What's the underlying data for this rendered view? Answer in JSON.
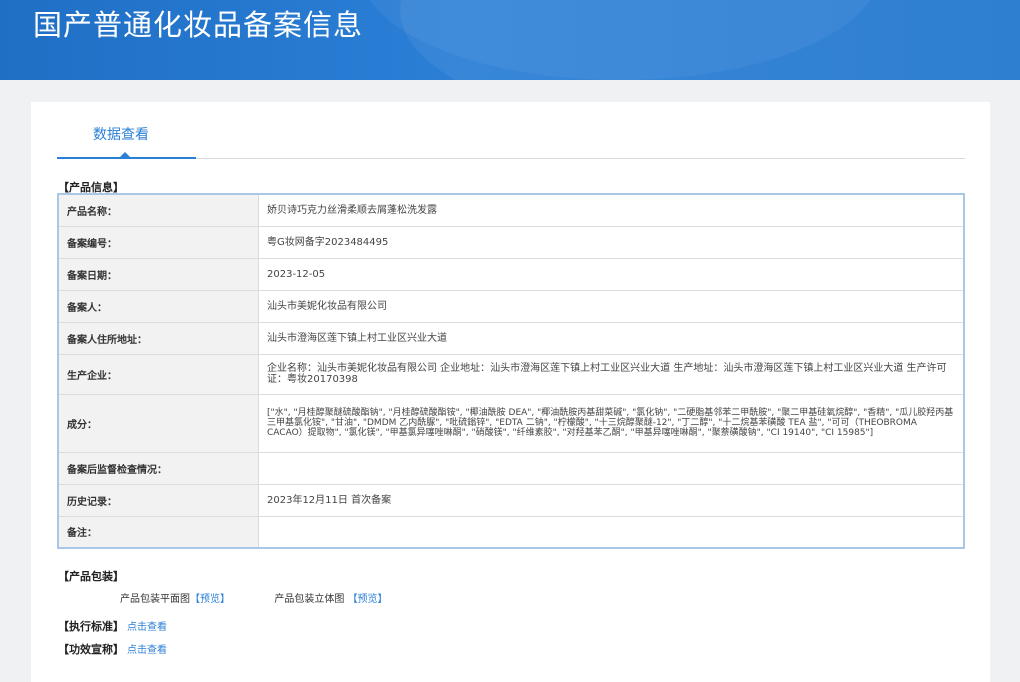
{
  "header": {
    "title": "国产普通化妆品备案信息"
  },
  "tabs": [
    {
      "label": "数据查看"
    }
  ],
  "product_section": {
    "title": "【产品信息】",
    "rows": [
      {
        "label": "产品名称：",
        "value": "娇贝诗巧克力丝滑柔顺去屑蓬松洗发露"
      },
      {
        "label": "备案编号：",
        "value": "粤G妆网备字2023484495"
      },
      {
        "label": "备案日期：",
        "value": "2023-12-05"
      },
      {
        "label": "备案人：",
        "value": "汕头市美妮化妆品有限公司"
      },
      {
        "label": "备案人住所地址：",
        "value": "汕头市澄海区莲下镇上村工业区兴业大道"
      },
      {
        "label": "生产企业：",
        "value": "企业名称：汕头市美妮化妆品有限公司 企业地址：汕头市澄海区莲下镇上村工业区兴业大道 生产地址：汕头市澄海区莲下镇上村工业区兴业大道 生产许可证：粤妆20170398"
      },
      {
        "label": "成分：",
        "value": "[\"水\", \"月桂醇聚醚硫酸酯钠\", \"月桂醇硫酸酯铵\", \"椰油酰胺 DEA\", \"椰油酰胺丙基甜菜碱\", \"氯化钠\", \"二硬脂基邻苯二甲酰胺\", \"聚二甲基硅氧烷醇\", \"香精\", \"瓜儿胶羟丙基三甲基氯化铵\", \"甘油\", \"DMDM 乙内酰脲\", \"吡硫鎓锌\", \"EDTA 二钠\", \"柠檬酸\", \"十三烷醇聚醚-12\", \"丁二醇\", \"十二烷基苯磺酸 TEA 盐\", \"可可（THEOBROMA CACAO）提取物\", \"氯化镁\", \"甲基氯异噻唑啉酮\", \"硝酸镁\", \"纤维素胶\", \"对羟基苯乙酮\", \"甲基异噻唑啉酮\", \"聚萘磺酸钠\", \"CI 19140\", \"CI 15985\"]"
      },
      {
        "label": "备案后监督检查情况：",
        "value": ""
      },
      {
        "label": "历史记录：",
        "value": "2023年12月11日 首次备案"
      },
      {
        "label": "备注：",
        "value": ""
      }
    ]
  },
  "packaging": {
    "title": "【产品包装】",
    "flat_label": "产品包装平面图",
    "flat_link": "【预览】",
    "stereo_label": "产品包装立体图",
    "stereo_link": "【预览】"
  },
  "standard": {
    "title": "【执行标准】",
    "link": "点击查看"
  },
  "claims": {
    "title": "【功效宣称】",
    "link": "点击查看"
  }
}
